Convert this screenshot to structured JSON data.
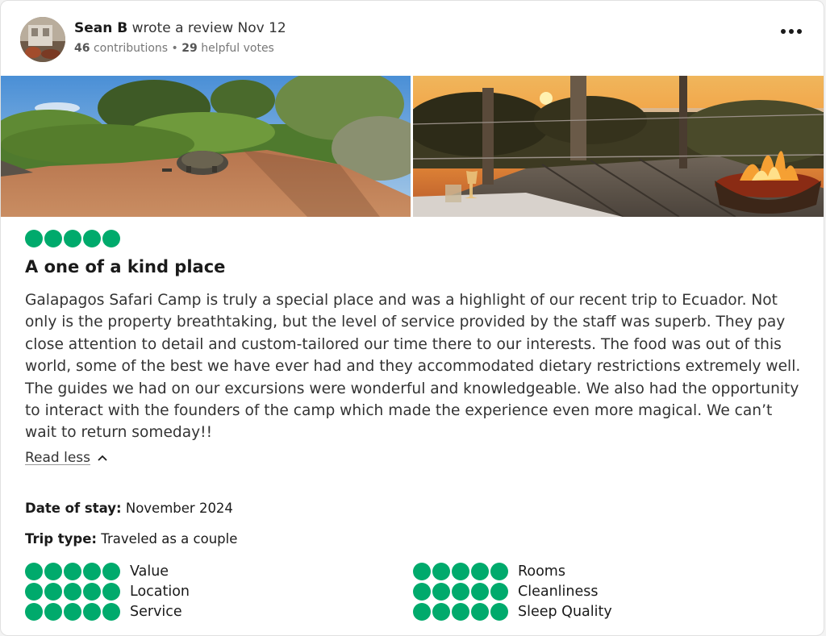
{
  "review": {
    "author": "Sean B",
    "action_text": "wrote a review Nov 12",
    "contributions": "46",
    "contributions_label": "contributions",
    "separator": "•",
    "helpful_votes": "29",
    "helpful_votes_label": "helpful votes",
    "rating": 5,
    "title": "A one of a kind place",
    "body": "Galapagos Safari Camp is truly a special place and was a highlight of our recent trip to Ecuador. Not only is the property breathtaking, but the level of service provided by the staff was superb. They pay close attention to detail and custom-tailored our time there to our interests. The food was out of this world, some of the best we have ever had and they accommodated dietary restrictions extremely well. The guides we had on our excursions were wonderful and knowledgeable. We also had the opportunity to interact with the founders of the camp which made the experience even more magical. We can’t wait to return someday!!",
    "read_less_label": "Read less",
    "date_of_stay_label": "Date of stay:",
    "date_of_stay_value": "November 2024",
    "trip_type_label": "Trip type:",
    "trip_type_value": "Traveled as a couple"
  },
  "photos": [
    {
      "name": "tortoise-on-dirt-road-photo"
    },
    {
      "name": "sunset-deck-firepit-photo"
    }
  ],
  "sub_ratings": {
    "left": [
      {
        "label": "Value",
        "rating": 5
      },
      {
        "label": "Location",
        "rating": 5
      },
      {
        "label": "Service",
        "rating": 5
      }
    ],
    "right": [
      {
        "label": "Rooms",
        "rating": 5
      },
      {
        "label": "Cleanliness",
        "rating": 5
      },
      {
        "label": "Sleep Quality",
        "rating": 5
      }
    ]
  },
  "icons": {
    "more": "more-options-icon",
    "chevron": "chevron-up-icon"
  },
  "colors": {
    "bubble": "#00aa6c",
    "text": "#1a1a1a",
    "muted": "#777777"
  }
}
